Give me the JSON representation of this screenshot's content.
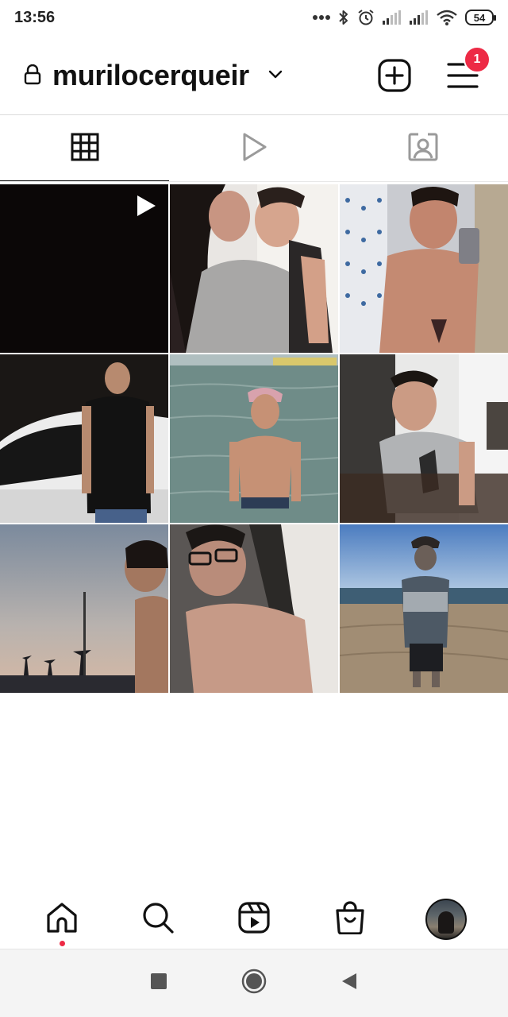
{
  "status_bar": {
    "time": "13:56",
    "battery": "54",
    "icons": [
      "more-dots-icon",
      "bluetooth-icon",
      "alarm-icon",
      "signal-icon",
      "signal-icon",
      "wifi-icon",
      "battery-icon"
    ]
  },
  "profile": {
    "username": "murilocerqueir",
    "notification_count": "1",
    "icons": {
      "lock": "lock-icon",
      "switch": "chevron-down-icon",
      "create": "plus-square-icon",
      "menu": "hamburger-menu-icon"
    }
  },
  "tabs": [
    {
      "icon": "grid-icon",
      "active": true
    },
    {
      "icon": "reels-play-icon",
      "active": false
    },
    {
      "icon": "tagged-person-icon",
      "active": false
    }
  ],
  "posts": [
    {
      "kind": "reel"
    },
    {
      "kind": "photo"
    },
    {
      "kind": "photo"
    },
    {
      "kind": "photo"
    },
    {
      "kind": "photo"
    },
    {
      "kind": "photo"
    },
    {
      "kind": "photo"
    },
    {
      "kind": "photo"
    },
    {
      "kind": "photo"
    }
  ],
  "bottom_nav": [
    {
      "icon": "home-icon",
      "active": true
    },
    {
      "icon": "search-icon"
    },
    {
      "icon": "reels-icon"
    },
    {
      "icon": "shop-bag-icon"
    },
    {
      "icon": "profile-avatar"
    }
  ],
  "system_nav": [
    "recents-square-icon",
    "home-circle-icon",
    "back-triangle-icon"
  ],
  "colors": {
    "badge": "#ed2a45",
    "text": "#111111",
    "divider": "#dbdbdb"
  }
}
